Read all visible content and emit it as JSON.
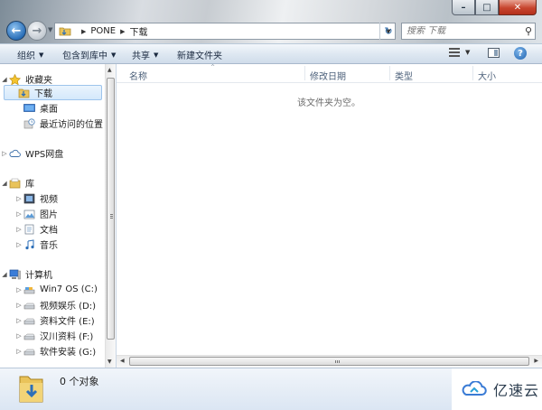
{
  "window": {
    "caption_buttons": {
      "minimize": "–",
      "maximize": "□",
      "close": "✕"
    }
  },
  "address": {
    "path": [
      "PONE",
      "下载"
    ],
    "refresh_icon": "refresh-icon"
  },
  "search": {
    "placeholder": "搜索 下载"
  },
  "toolbar": {
    "organize": "组织",
    "include_in_library": "包含到库中",
    "share": "共享",
    "new_folder": "新建文件夹"
  },
  "sidebar": {
    "favorites": {
      "label": "收藏夹",
      "items": [
        "下载",
        "桌面",
        "最近访问的位置"
      ]
    },
    "wps": "WPS网盘",
    "libraries": {
      "label": "库",
      "items": [
        "视频",
        "图片",
        "文档",
        "音乐"
      ]
    },
    "computer": {
      "label": "计算机",
      "items": [
        "Win7 OS (C:)",
        "视频娱乐 (D:)",
        "资料文件 (E:)",
        "汉川资料 (F:)",
        "软件安装 (G:)"
      ]
    }
  },
  "columns": [
    "名称",
    "修改日期",
    "类型",
    "大小"
  ],
  "content": {
    "empty_text": "该文件夹为空。"
  },
  "details": {
    "item_count": "0 个对象"
  },
  "watermark": {
    "text": "亿速云"
  },
  "colors": {
    "selection": "#d4e8fb",
    "selection_border": "#9dc4ec",
    "close_button": "#c7452e",
    "toolbar_bg": "#dde7f1"
  }
}
